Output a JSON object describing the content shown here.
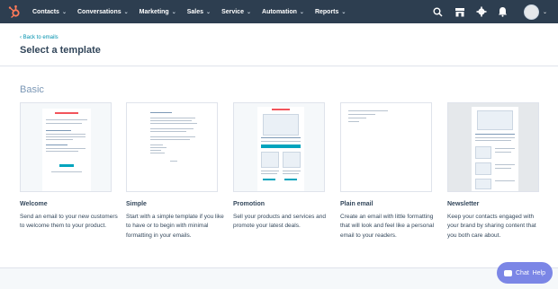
{
  "nav": {
    "items": [
      {
        "label": "Contacts"
      },
      {
        "label": "Conversations"
      },
      {
        "label": "Marketing"
      },
      {
        "label": "Sales"
      },
      {
        "label": "Service"
      },
      {
        "label": "Automation"
      },
      {
        "label": "Reports"
      }
    ],
    "chevron": "⌄",
    "brand_color": "#ff7a59",
    "bar_color": "#2d3e50"
  },
  "header": {
    "back_label": "‹ Back to emails",
    "title": "Select a template"
  },
  "section": {
    "title": "Basic"
  },
  "templates": [
    {
      "name": "Welcome",
      "desc": "Send an email to your new customers to welcome them to your product."
    },
    {
      "name": "Simple",
      "desc": "Start with a simple template if you like to have or to begin with minimal formatting in your emails."
    },
    {
      "name": "Promotion",
      "desc": "Sell your products and services and promote your latest deals."
    },
    {
      "name": "Plain email",
      "desc": "Create an email with little formatting that will look and feel like a personal email to your readers."
    },
    {
      "name": "Newsletter",
      "desc": "Keep your contacts engaged with your brand by sharing content that you both care about."
    }
  ],
  "chat": {
    "chat_label": "Chat",
    "help_label": "Help",
    "color": "#7b86e6"
  }
}
